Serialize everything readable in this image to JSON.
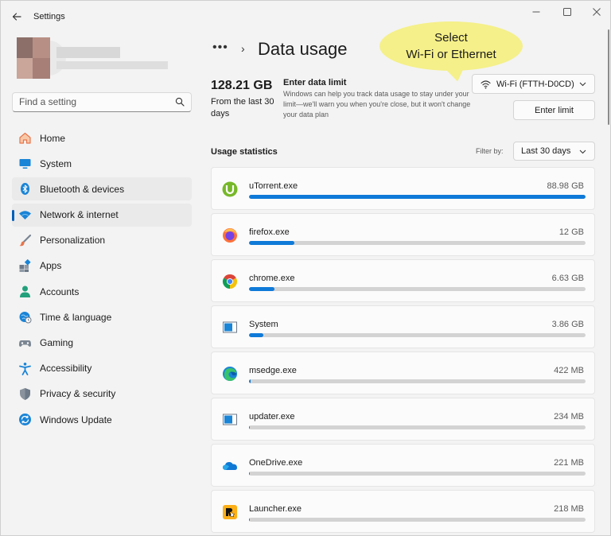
{
  "window": {
    "title": "Settings"
  },
  "search": {
    "placeholder": "Find a setting"
  },
  "nav": [
    {
      "label": "Home",
      "icon": "home-icon"
    },
    {
      "label": "System",
      "icon": "system-icon"
    },
    {
      "label": "Bluetooth & devices",
      "icon": "bluetooth-icon"
    },
    {
      "label": "Network & internet",
      "icon": "network-icon",
      "active": true
    },
    {
      "label": "Personalization",
      "icon": "brush-icon"
    },
    {
      "label": "Apps",
      "icon": "apps-icon"
    },
    {
      "label": "Accounts",
      "icon": "accounts-icon"
    },
    {
      "label": "Time & language",
      "icon": "time-language-icon"
    },
    {
      "label": "Gaming",
      "icon": "gaming-icon"
    },
    {
      "label": "Accessibility",
      "icon": "accessibility-icon"
    },
    {
      "label": "Privacy & security",
      "icon": "shield-icon"
    },
    {
      "label": "Windows Update",
      "icon": "windows-update-icon"
    }
  ],
  "breadcrumb": {
    "more": "•••",
    "separator": "›",
    "title": "Data usage"
  },
  "callout": {
    "line1": "Select",
    "line2": "Wi-Fi or Ethernet"
  },
  "summary": {
    "total": "128.21 GB",
    "period": "From the last 30 days",
    "limit_title": "Enter data limit",
    "limit_desc": "Windows can help you track data usage to stay under your limit—we'll warn you when you're close, but it won't change your data plan"
  },
  "network_select": {
    "value": "Wi-Fi (FTTH-D0CD)"
  },
  "enter_limit_label": "Enter limit",
  "usage": {
    "title": "Usage statistics",
    "filter_label": "Filter by:",
    "filter_value": "Last 30 days",
    "apps": [
      {
        "name": "uTorrent.exe",
        "usage": "88.98 GB",
        "fraction": 1.0,
        "icon": "utorrent-icon"
      },
      {
        "name": "firefox.exe",
        "usage": "12 GB",
        "fraction": 0.135,
        "icon": "firefox-icon"
      },
      {
        "name": "chrome.exe",
        "usage": "6.63 GB",
        "fraction": 0.075,
        "icon": "chrome-icon"
      },
      {
        "name": "System",
        "usage": "3.86 GB",
        "fraction": 0.043,
        "icon": "system-app-icon"
      },
      {
        "name": "msedge.exe",
        "usage": "422 MB",
        "fraction": 0.005,
        "icon": "edge-icon"
      },
      {
        "name": "updater.exe",
        "usage": "234 MB",
        "fraction": 0.003,
        "icon": "updater-icon"
      },
      {
        "name": "OneDrive.exe",
        "usage": "221 MB",
        "fraction": 0.003,
        "icon": "onedrive-icon"
      },
      {
        "name": "Launcher.exe",
        "usage": "218 MB",
        "fraction": 0.003,
        "icon": "rockstar-launcher-icon"
      }
    ]
  },
  "colors": {
    "accent": "#0f7ad8",
    "callout": "#f5f089"
  }
}
